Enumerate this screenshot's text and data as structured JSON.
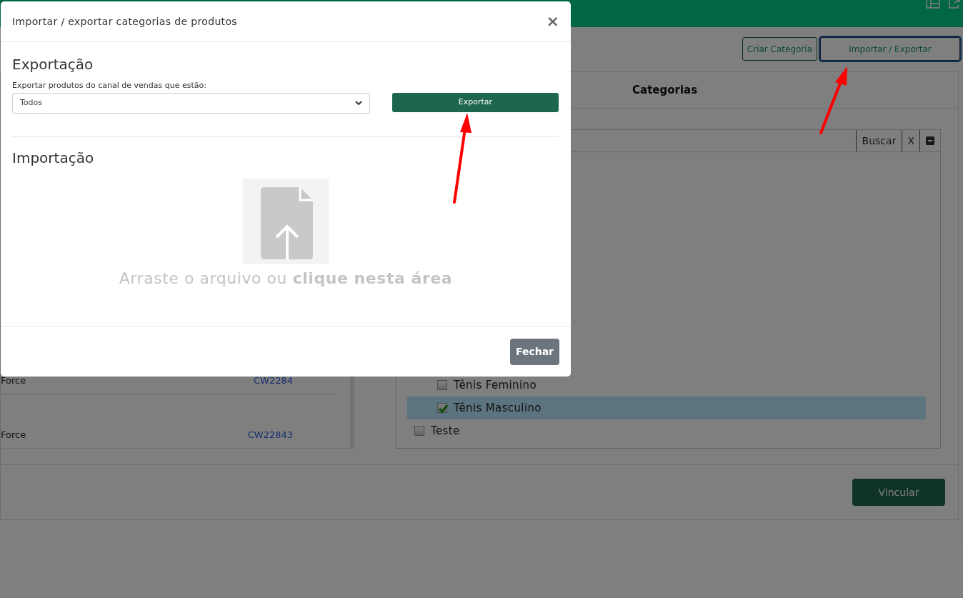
{
  "page": {
    "toolbar_buttons": [
      {
        "label": "Criar Categoria",
        "focused": false
      },
      {
        "label": "Importar / Exportar",
        "focused": true
      }
    ],
    "products": [
      {
        "name": "Force",
        "code": "CW2284"
      },
      {
        "name": "Force",
        "code": "CW22843"
      }
    ],
    "categories": {
      "title": "Categorias",
      "search_button": "Buscar",
      "clear_button": "X",
      "tree": [
        {
          "children": [
            {
              "label": "Tênis Feminino",
              "checked": false,
              "selected": false
            },
            {
              "label": "Tênis Masculino",
              "checked": true,
              "selected": true
            }
          ]
        },
        {
          "label": "Teste",
          "checked": false,
          "selected": false
        }
      ]
    },
    "link_button": "Vincular"
  },
  "modal": {
    "title": "Importar / exportar categorias de produtos",
    "close": "×",
    "export": {
      "heading": "Exportação",
      "select_label": "Exportar produtos do canal de vendas que estão:",
      "select_value": "Todos",
      "button": "Exportar"
    },
    "import": {
      "heading": "Importação",
      "dropzone_text": "Arraste o arquivo ou **clique nesta área**"
    },
    "footer_button": "Fechar"
  }
}
